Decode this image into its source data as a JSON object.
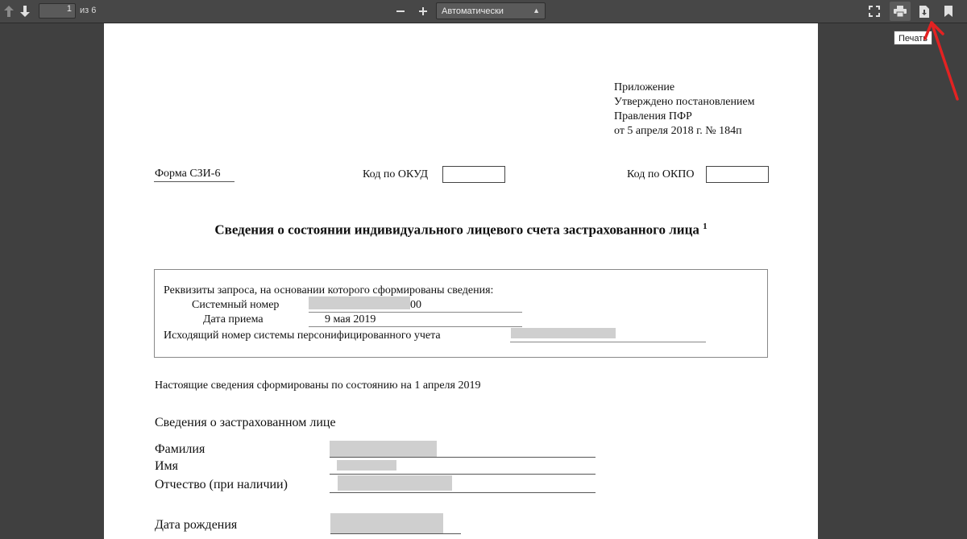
{
  "viewer": {
    "page_current": "1",
    "page_total_label": "из 6",
    "zoom_value": "Автоматически",
    "tooltip": "Печать",
    "icons": [
      "up-arrow-icon",
      "down-arrow-icon",
      "zoom-out-icon",
      "zoom-in-icon",
      "fullscreen-icon",
      "print-icon",
      "download-icon",
      "bookmark-icon"
    ]
  },
  "document": {
    "header_lines": [
      "Приложение",
      "Утверждено постановлением",
      "Правления ПФР",
      "от 5 апреля 2018 г. № 184п"
    ],
    "form_label": "Форма СЗИ-6",
    "okud_label": "Код по ОКУД",
    "okpo_label": "Код по ОКПО",
    "title": "Сведения о состоянии индивидуального лицевого счета застрахованного лица",
    "title_footnote": "1",
    "request": {
      "heading": "Реквизиты запроса, на основании которого сформированы сведения:",
      "system_number_label": "Системный номер",
      "system_number_visible_suffix": "00",
      "receipt_date_label": "Дата приема",
      "receipt_date_value": "9 мая 2019",
      "outgoing_number_label": "Исходящий номер системы персонифицированного учета"
    },
    "state_line": "Настоящие сведения сформированы по состоянию на 1 апреля 2019",
    "insured_heading": "Сведения о застрахованном лице",
    "fields": {
      "surname": "Фамилия",
      "name": "Имя",
      "patronymic": "Отчество (при наличии)",
      "birth_date": "Дата рождения"
    }
  }
}
